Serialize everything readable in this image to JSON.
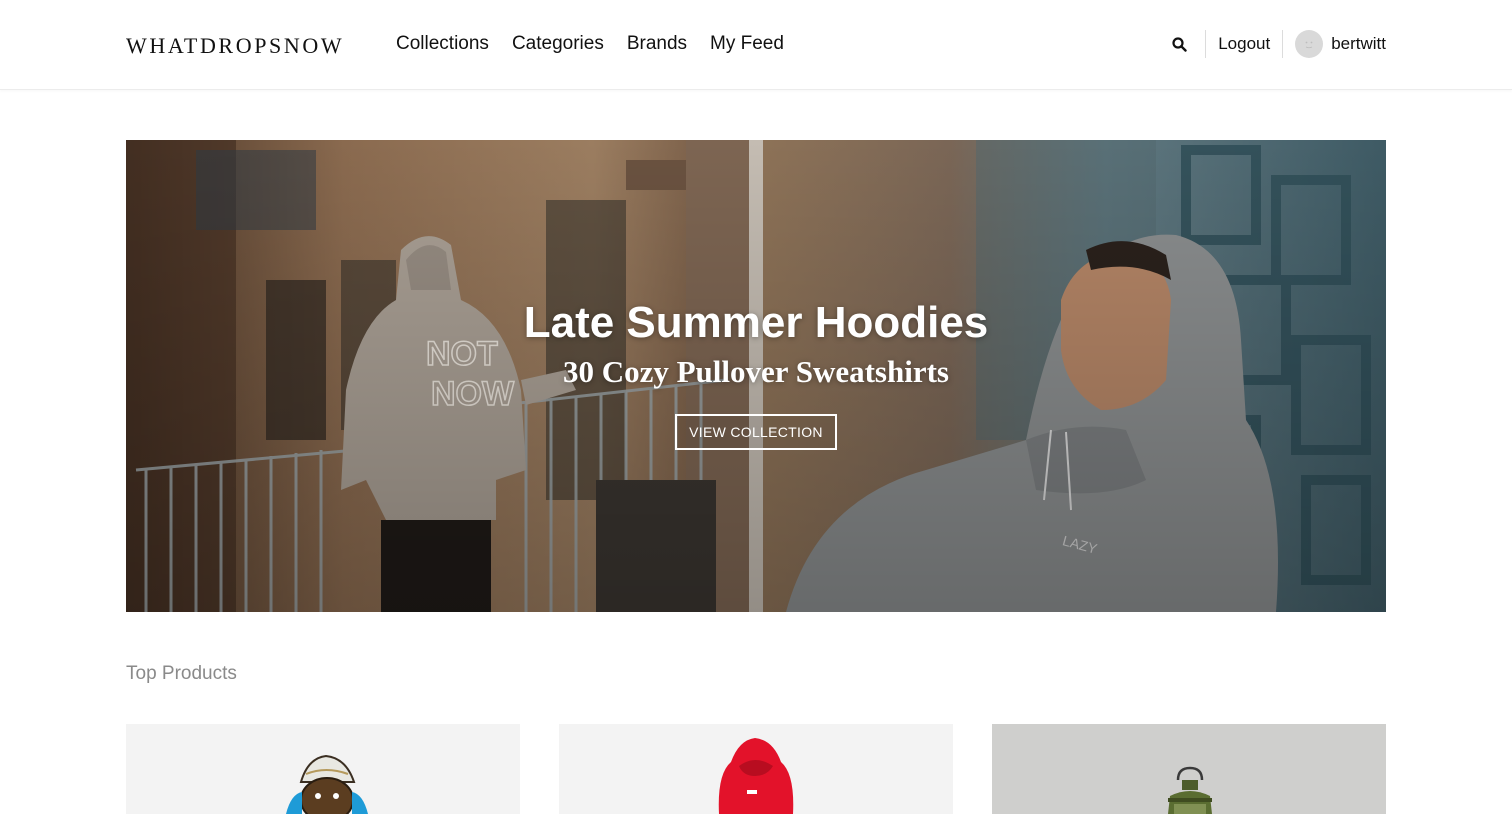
{
  "header": {
    "logo": "WHATDROPSNOW",
    "nav": [
      "Collections",
      "Categories",
      "Brands",
      "My Feed"
    ],
    "logout_label": "Logout",
    "username": "bertwitt"
  },
  "hero": {
    "title": "Late Summer Hoodies",
    "subtitle": "30 Cozy Pullover Sweatshirts",
    "button_label": "VIEW COLLECTION"
  },
  "section": {
    "title": "Top Products"
  },
  "products": [
    {
      "image": "cartoon-character-product-image"
    },
    {
      "image": "red-hoodie-product-image"
    },
    {
      "image": "green-lantern-product-image"
    }
  ],
  "colors": {
    "text": "#111111",
    "muted": "#8a8a8a",
    "card_bg": "#f3f3f3",
    "hoodie_red": "#e3122a"
  }
}
